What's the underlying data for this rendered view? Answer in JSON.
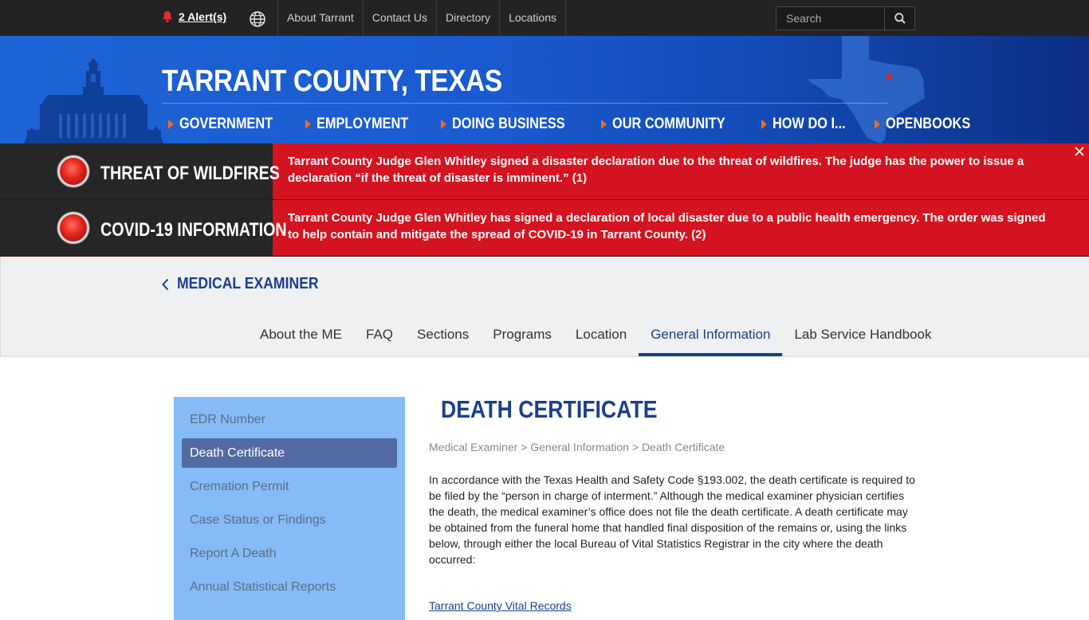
{
  "topbar": {
    "alert_label": "2 Alert(s)",
    "links": [
      "About Tarrant",
      "Contact Us",
      "Directory",
      "Locations"
    ],
    "search_placeholder": "Search"
  },
  "header": {
    "title": "TARRANT COUNTY, TEXAS",
    "nav": [
      "GOVERNMENT",
      "EMPLOYMENT",
      "DOING BUSINESS",
      "OUR COMMUNITY",
      "HOW DO I...",
      "OPENBOOKS"
    ]
  },
  "alerts": [
    {
      "label": "THREAT OF WILDFIRES",
      "message": "Tarrant County Judge Glen Whitley signed a disaster declaration due to the threat of wildfires. The judge has the power to issue a declaration “if the threat of disaster is imminent.” (1)"
    },
    {
      "label": "COVID-19 INFORMATION",
      "message": "Tarrant County Judge Glen Whitley has signed a declaration of local disaster due to a public health emergency. The order was signed to help contain and mitigate the spread of COVID-19 in Tarrant County. (2)"
    }
  ],
  "section": {
    "back_label": "MEDICAL EXAMINER",
    "tabs": [
      "About the ME",
      "FAQ",
      "Sections",
      "Programs",
      "Location",
      "General Information",
      "Lab Service Handbook"
    ],
    "active_tab": "General Information"
  },
  "sidebar": {
    "items": [
      "EDR Number",
      "Death Certificate",
      "Cremation Permit",
      "Case Status or Findings",
      "Report A Death",
      "Annual Statistical Reports"
    ],
    "active": "Death Certificate"
  },
  "content": {
    "title": "DEATH CERTIFICATE",
    "breadcrumb": [
      "Medical Examiner",
      "General Information",
      "Death Certificate"
    ],
    "breadcrumb_sep": ">",
    "paragraph": "In accordance with the Texas Health and Safety Code §193.002, the death certificate is required to be filed by the “person in charge of interment.”  Although the medical examiner physician certifies the death, the medical examiner’s office does not file the death certificate.  A death certificate may be obtained from the funeral home that handled final disposition of the remains or, using the links below, through either the local Bureau of Vital Statistics Registrar in the city where the death occurred:",
    "link": "Tarrant County Vital Records"
  },
  "colors": {
    "topbar": "#232323",
    "banner_blue": "#1a5ad0",
    "alert_red": "#d41421",
    "accent_navy": "#1b3f8b",
    "nav_arrow": "#ef6a2a",
    "sidebar_bg": "#86bbf7",
    "sidebar_active": "#526ba2"
  }
}
